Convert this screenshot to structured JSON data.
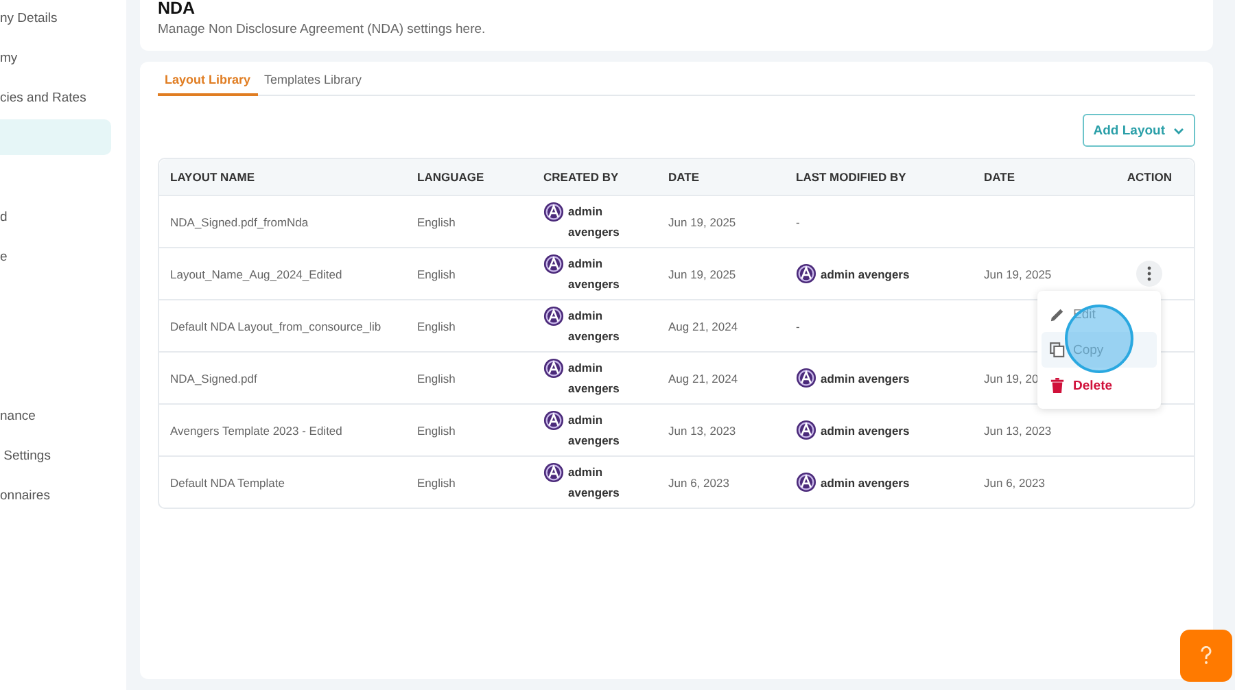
{
  "sidebar": {
    "items": [
      {
        "label": "ny Details",
        "selected": false
      },
      {
        "label": "my",
        "selected": false
      },
      {
        "label": "cies and Rates",
        "selected": false
      },
      {
        "selected": true
      },
      {
        "selected": false
      },
      {
        "label": "d",
        "selected": false
      },
      {
        "label": "e",
        "selected": false
      },
      {
        "selected": false
      },
      {
        "selected": false
      },
      {
        "selected": false
      },
      {
        "label": "nance",
        "selected": false
      },
      {
        "label": " Settings",
        "selected": false
      },
      {
        "label": "onnaires",
        "selected": false
      }
    ]
  },
  "header": {
    "title": "NDA",
    "subtitle": "Manage Non Disclosure Agreement (NDA) settings here."
  },
  "tabs": [
    {
      "label": "Layout Library",
      "selected": true
    },
    {
      "label": "Templates Library",
      "selected": false
    }
  ],
  "add_button": {
    "label": "Add Layout"
  },
  "table": {
    "columns": [
      "LAYOUT NAME",
      "LANGUAGE",
      "CREATED BY",
      "DATE",
      "LAST MODIFIED BY",
      "DATE",
      "ACTION"
    ],
    "rows": [
      {
        "layout_name": "NDA_Signed.pdf_fromNda",
        "language": "English",
        "created_by": "admin avengers",
        "date": "Jun 19, 2025",
        "last_modified": {
          "kind": "empty",
          "name": "-"
        },
        "menu_open": false
      },
      {
        "layout_name": "Layout_Name_Aug_2024_Edited",
        "language": "English",
        "created_by": "admin avengers",
        "date": "Jun 19, 2025",
        "last_modified": {
          "kind": "user",
          "name": "admin avengers"
        },
        "modified_date": "Jun 19, 2025",
        "menu_open": true
      },
      {
        "layout_name": "Default NDA Layout_from_consource_lib",
        "language": "English",
        "created_by": "admin avengers",
        "date": "Aug 21, 2024",
        "last_modified": {
          "kind": "empty",
          "name": "-"
        },
        "menu_open": false
      },
      {
        "layout_name": "NDA_Signed.pdf",
        "language": "English",
        "created_by": "admin avengers",
        "date": "Aug 21, 2024",
        "last_modified": {
          "kind": "user",
          "name": "admin avengers"
        },
        "modified_date": "Jun 19, 20",
        "menu_open": false
      },
      {
        "layout_name": "Avengers Template 2023 - Edited",
        "language": "English",
        "created_by": "admin avengers",
        "date": "Jun 13, 2023",
        "last_modified": {
          "kind": "user",
          "name": "admin avengers"
        },
        "modified_date": "Jun 13, 2023",
        "menu_open": false
      },
      {
        "layout_name": "Default NDA Template",
        "language": "English",
        "created_by": "admin avengers",
        "date": "Jun 6, 2023",
        "last_modified": {
          "kind": "user",
          "name": "admin avengers"
        },
        "modified_date": "Jun 6, 2023",
        "menu_open": false
      }
    ]
  },
  "action_menu": {
    "cursor_highlight": true,
    "items": [
      {
        "kind": "edit",
        "label": "Edit",
        "highlighted": false
      },
      {
        "kind": "copy",
        "label": "Copy",
        "highlighted": true
      },
      {
        "kind": "delete",
        "label": "Delete",
        "highlighted": false
      }
    ]
  }
}
